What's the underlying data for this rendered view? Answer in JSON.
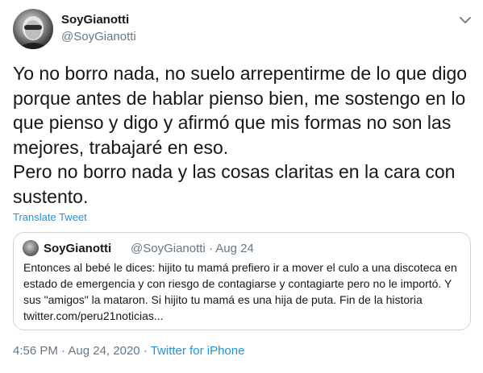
{
  "tweet": {
    "display_name": "SoyGianotti",
    "handle": "@SoyGianotti",
    "body": "Yo no borro nada, no suelo arrepentirme de lo que digo porque antes de hablar pienso bien, me sostengo en lo que pienso y digo y afirmó que mis formas no son las mejores, trabajaré en eso.\nPero no borro nada y las cosas claritas en la cara con sustento.",
    "translate_label": "Translate Tweet",
    "time": "4:56 PM",
    "date": "Aug 24, 2020",
    "source": "Twitter for iPhone",
    "separator": "·"
  },
  "quoted": {
    "display_name": "SoyGianotti",
    "handle": "@SoyGianotti",
    "separator": "·",
    "date": "Aug 24",
    "text": "Entonces al bebé le dices: hijito tu mamá prefiero ir a mover el culo a una discoteca en estado de emergencia y con riesgo de contagiarse y contagiarte pero no le importó. Y sus \"amigos\" la mataron. Si hijito tu mamá es una hija de puta. Fin de la historia twitter.com/peru21noticias..."
  },
  "icons": {
    "caret": "chevron-down-icon",
    "accent": "#1b95e0",
    "muted": "#657786",
    "border": "#ccd6dd"
  }
}
